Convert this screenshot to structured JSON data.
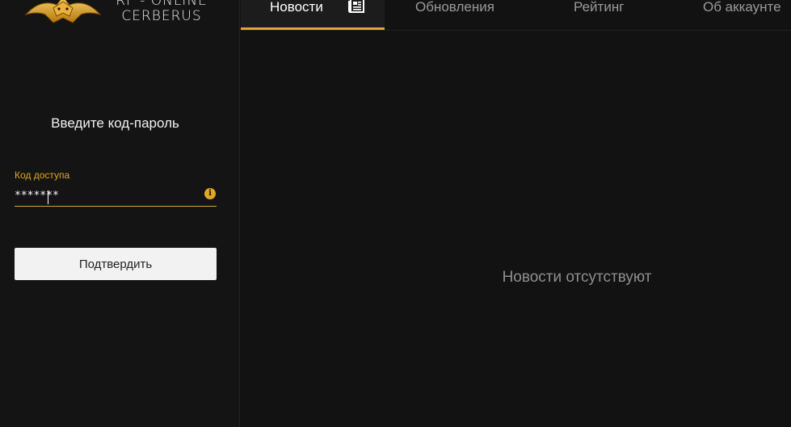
{
  "brand": {
    "line1": "RF - ONLINE",
    "line2": "CERBERUS",
    "accent_color": "#e0a826"
  },
  "login": {
    "title": "Введите код-пароль",
    "field_label": "Код доступа",
    "password_value": "*******",
    "info_icon": "info-icon",
    "confirm_label": "Подтвердить"
  },
  "tabs": [
    {
      "label": "Новости",
      "active": true,
      "icon": "newspaper-icon"
    },
    {
      "label": "Обновления",
      "active": false
    },
    {
      "label": "Рейтинг",
      "active": false
    },
    {
      "label": "Об аккаунте",
      "active": false
    }
  ],
  "main": {
    "empty_message": "Новости отсутствуют"
  }
}
